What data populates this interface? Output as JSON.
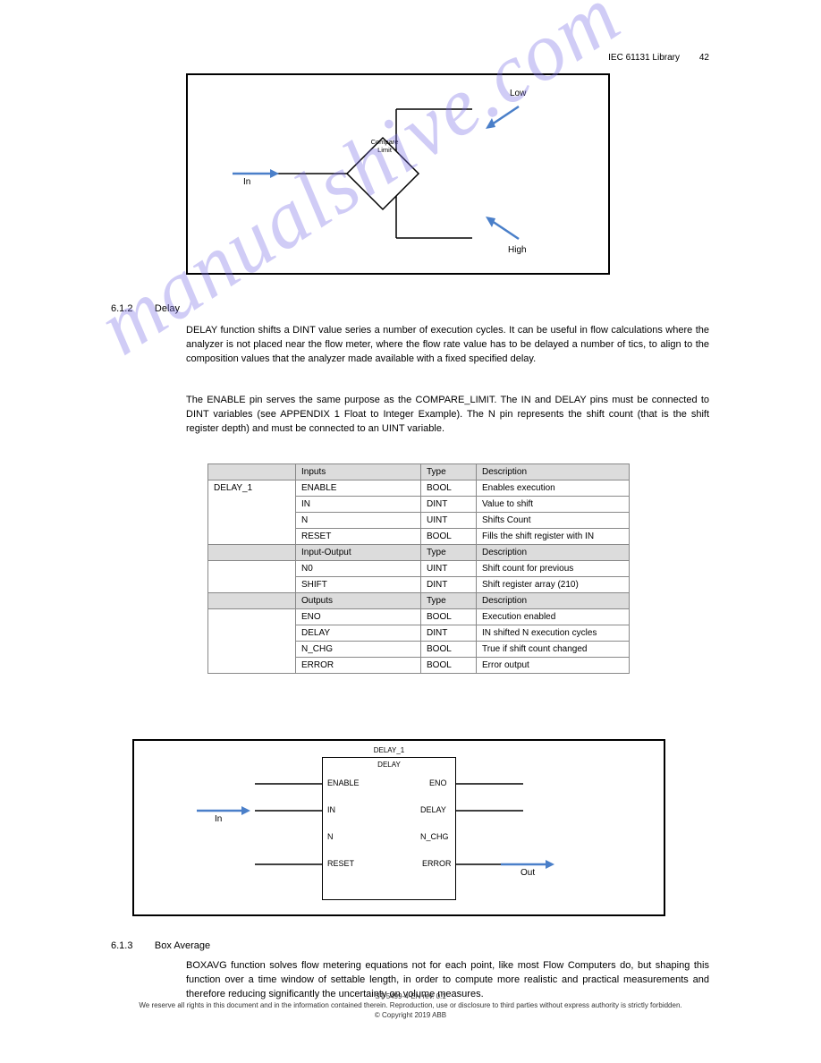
{
  "header": {
    "right_text": "IEC 61131 Library",
    "page_num": "42"
  },
  "fig1": {
    "compare": "Compare\nLimit",
    "in": "In",
    "low": "Low",
    "high": "High"
  },
  "section1": {
    "num": "6.1.2",
    "title": "Delay",
    "p1": "DELAY function shifts a DINT value series a number of execution cycles. It can be useful in flow calculations where the analyzer is not placed near the flow meter, where the flow rate value has to be delayed a number of tics, to align to the composition values that the analyzer made available with a fixed specified delay.",
    "p2": "The ENABLE pin serves the same purpose as the COMPARE_LIMIT. The IN and DELAY pins must be connected to DINT variables (see APPENDIX 1 Float to Integer Example). The N pin represents the shift count (that is the shift register depth) and must be connected to an UINT variable."
  },
  "table": {
    "h1": [
      "Inputs",
      "Type",
      "Description"
    ],
    "r1": [
      "DELAY_1",
      "ENABLE",
      "BOOL",
      "Enables execution"
    ],
    "r2": [
      "",
      "IN",
      "DINT",
      "Value to shift"
    ],
    "r3": [
      "",
      "N",
      "UINT",
      "Shifts Count"
    ],
    "r4": [
      "",
      "RESET",
      "BOOL",
      "Fills the shift register with IN"
    ],
    "h2": [
      "",
      "Input-Output",
      "Type",
      "Description"
    ],
    "r5": [
      "",
      "N0",
      "UINT",
      "Shift count for previous"
    ],
    "r6": [
      "",
      "SHIFT",
      "DINT",
      "Shift register array (210)"
    ],
    "h3": [
      "",
      "Outputs",
      "Type",
      "Description"
    ],
    "r7": [
      "",
      "ENO",
      "BOOL",
      "Execution enabled"
    ],
    "r8": [
      "",
      "DELAY",
      "DINT",
      "IN shifted N execution cycles"
    ],
    "r9": [
      "",
      "N_CHG",
      "BOOL",
      "True if shift count changed"
    ],
    "r10": [
      "",
      "ERROR",
      "BOOL",
      "Error output"
    ]
  },
  "fig2": {
    "title": "DELAY_1",
    "sub": "DELAY",
    "enable": "ENABLE",
    "in": "IN",
    "n": "N",
    "reset": "RESET",
    "eno": "ENO",
    "delay": "DELAY",
    "n_chg": "N_CHG",
    "error": "ERROR",
    "arrow_in": "In",
    "arrow_out": "Out"
  },
  "section2": {
    "num": "6.1.3",
    "title": "Box Average",
    "p1": "BOXAVG function solves flow metering equations not for each point, like most Flow Computers do, but shaping this function over a time window of settable length, in order to compute more realistic and practical measurements and therefore reducing significantly the uncertainty on volume measures."
  },
  "footer": {
    "line1": "ST-5499-4-EN rev. 0.1",
    "line2": "We reserve all rights in this document and in the information contained therein. Reproduction, use or disclosure to third parties without express authority is strictly forbidden.",
    "line3": "© Copyright 2019 ABB"
  }
}
